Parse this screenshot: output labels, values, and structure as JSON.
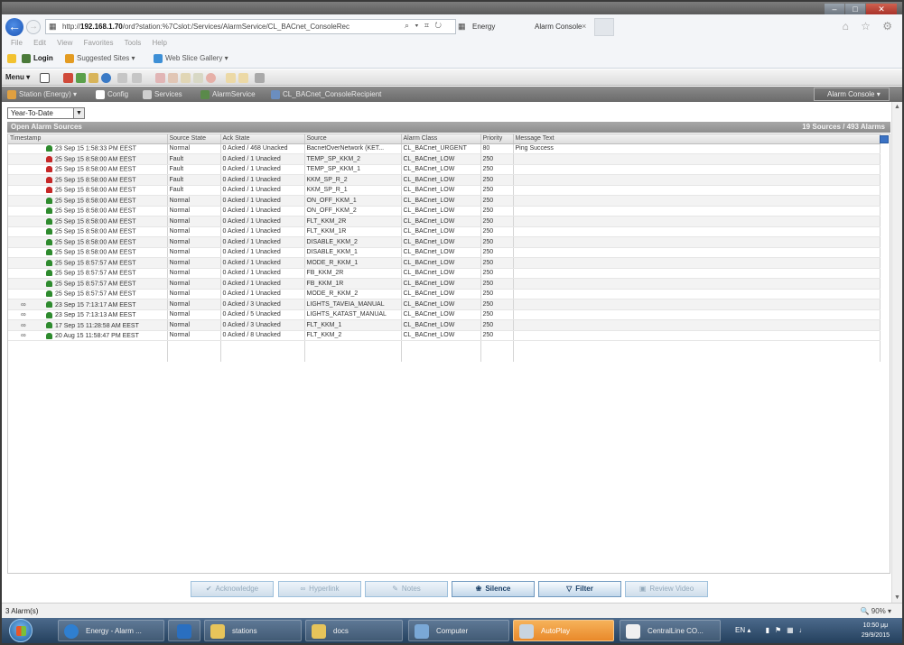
{
  "browser": {
    "url_prefix": "http://",
    "url_host": "192.168.1.70",
    "url_path": "/ord?station:%7Cslot:/Services/AlarmService/CL_BACnet_ConsoleRec",
    "url_tools": "⌕ ▾ ⌗ ↻",
    "tab_title": "Energy",
    "tab_title_2": "Alarm Console",
    "tab_close": "×",
    "right_icons": "⌂ ☆ ⚙"
  },
  "window_controls": {
    "minimize": "–",
    "maximize": "□",
    "close": "✕"
  },
  "menu": [
    "File",
    "Edit",
    "View",
    "Favorites",
    "Tools",
    "Help"
  ],
  "favorites": {
    "login": "Login",
    "suggested": "Suggested Sites ▾",
    "gallery": "Web Slice Gallery ▾"
  },
  "toolbar": {
    "menu_label": "Menu ▾"
  },
  "breadcrumb": {
    "station": "Station (Energy) ▾",
    "config": "Config",
    "services": "Services",
    "alarm_service": "AlarmService",
    "console_recipient": "CL_BACnet_ConsoleRecipient",
    "view_selector": "Alarm Console ▾"
  },
  "filter": {
    "range": "Year-To-Date",
    "dropdown": "▼"
  },
  "panel": {
    "title": "Open Alarm Sources",
    "count": "19 Sources / 493 Alarms"
  },
  "table": {
    "columns": [
      "Timestamp",
      "Source State",
      "Ack State",
      "Source",
      "Alarm Class",
      "Priority",
      "Message Text"
    ],
    "rows": [
      {
        "icon": "green",
        "ts": "23 Sep 15 1:58:33 PM EEST",
        "state": "Normal",
        "ack": "0 Acked / 468 Unacked",
        "source": "BacnetOverNetwork (KET...",
        "cls": "CL_BACnet_URGENT",
        "pri": "80",
        "msg": "Ping Success",
        "extra": ""
      },
      {
        "icon": "red",
        "ts": "25 Sep 15 8:58:00 AM EEST",
        "state": "Fault",
        "ack": "0 Acked / 1 Unacked",
        "source": "TEMP_SP_KKM_2",
        "cls": "CL_BACnet_LOW",
        "pri": "250",
        "msg": "",
        "extra": ""
      },
      {
        "icon": "red",
        "ts": "25 Sep 15 8:58:00 AM EEST",
        "state": "Fault",
        "ack": "0 Acked / 1 Unacked",
        "source": "TEMP_SP_KKM_1",
        "cls": "CL_BACnet_LOW",
        "pri": "250",
        "msg": "",
        "extra": ""
      },
      {
        "icon": "red",
        "ts": "25 Sep 15 8:58:00 AM EEST",
        "state": "Fault",
        "ack": "0 Acked / 1 Unacked",
        "source": "KKM_SP_R_2",
        "cls": "CL_BACnet_LOW",
        "pri": "250",
        "msg": "",
        "extra": ""
      },
      {
        "icon": "red",
        "ts": "25 Sep 15 8:58:00 AM EEST",
        "state": "Fault",
        "ack": "0 Acked / 1 Unacked",
        "source": "KKM_SP_R_1",
        "cls": "CL_BACnet_LOW",
        "pri": "250",
        "msg": "",
        "extra": ""
      },
      {
        "icon": "green",
        "ts": "25 Sep 15 8:58:00 AM EEST",
        "state": "Normal",
        "ack": "0 Acked / 1 Unacked",
        "source": "ON_OFF_KKM_1",
        "cls": "CL_BACnet_LOW",
        "pri": "250",
        "msg": "",
        "extra": ""
      },
      {
        "icon": "green",
        "ts": "25 Sep 15 8:58:00 AM EEST",
        "state": "Normal",
        "ack": "0 Acked / 1 Unacked",
        "source": "ON_OFF_KKM_2",
        "cls": "CL_BACnet_LOW",
        "pri": "250",
        "msg": "",
        "extra": ""
      },
      {
        "icon": "green",
        "ts": "25 Sep 15 8:58:00 AM EEST",
        "state": "Normal",
        "ack": "0 Acked / 1 Unacked",
        "source": "FLT_KKM_2R",
        "cls": "CL_BACnet_LOW",
        "pri": "250",
        "msg": "",
        "extra": ""
      },
      {
        "icon": "green",
        "ts": "25 Sep 15 8:58:00 AM EEST",
        "state": "Normal",
        "ack": "0 Acked / 1 Unacked",
        "source": "FLT_KKM_1R",
        "cls": "CL_BACnet_LOW",
        "pri": "250",
        "msg": "",
        "extra": ""
      },
      {
        "icon": "green",
        "ts": "25 Sep 15 8:58:00 AM EEST",
        "state": "Normal",
        "ack": "0 Acked / 1 Unacked",
        "source": "DISABLE_KKM_2",
        "cls": "CL_BACnet_LOW",
        "pri": "250",
        "msg": "",
        "extra": ""
      },
      {
        "icon": "green",
        "ts": "25 Sep 15 8:58:00 AM EEST",
        "state": "Normal",
        "ack": "0 Acked / 1 Unacked",
        "source": "DISABLE_KKM_1",
        "cls": "CL_BACnet_LOW",
        "pri": "250",
        "msg": "",
        "extra": ""
      },
      {
        "icon": "green",
        "ts": "25 Sep 15 8:57:57 AM EEST",
        "state": "Normal",
        "ack": "0 Acked / 1 Unacked",
        "source": "MODE_R_KKM_1",
        "cls": "CL_BACnet_LOW",
        "pri": "250",
        "msg": "",
        "extra": ""
      },
      {
        "icon": "green",
        "ts": "25 Sep 15 8:57:57 AM EEST",
        "state": "Normal",
        "ack": "0 Acked / 1 Unacked",
        "source": "FB_KKM_2R",
        "cls": "CL_BACnet_LOW",
        "pri": "250",
        "msg": "",
        "extra": ""
      },
      {
        "icon": "green",
        "ts": "25 Sep 15 8:57:57 AM EEST",
        "state": "Normal",
        "ack": "0 Acked / 1 Unacked",
        "source": "FB_KKM_1R",
        "cls": "CL_BACnet_LOW",
        "pri": "250",
        "msg": "",
        "extra": ""
      },
      {
        "icon": "green",
        "ts": "25 Sep 15 8:57:57 AM EEST",
        "state": "Normal",
        "ack": "0 Acked / 1 Unacked",
        "source": "MODE_R_KKM_2",
        "cls": "CL_BACnet_LOW",
        "pri": "250",
        "msg": "",
        "extra": ""
      },
      {
        "icon": "green",
        "ts": "23 Sep 15 7:13:17 AM EEST",
        "state": "Normal",
        "ack": "0 Acked / 3 Unacked",
        "source": "LIGHTS_TAVEIA_MANUAL",
        "cls": "CL_BACnet_LOW",
        "pri": "250",
        "msg": "",
        "extra": "∞"
      },
      {
        "icon": "green",
        "ts": "23 Sep 15 7:13:13 AM EEST",
        "state": "Normal",
        "ack": "0 Acked / 5 Unacked",
        "source": "LIGHTS_KATAST_MANUAL",
        "cls": "CL_BACnet_LOW",
        "pri": "250",
        "msg": "",
        "extra": "∞"
      },
      {
        "icon": "green",
        "ts": "17 Sep 15 11:28:58 AM EEST",
        "state": "Normal",
        "ack": "0 Acked / 3 Unacked",
        "source": "FLT_KKM_1",
        "cls": "CL_BACnet_LOW",
        "pri": "250",
        "msg": "",
        "extra": "∞"
      },
      {
        "icon": "green",
        "ts": "20 Aug 15 11:58:47 PM EEST",
        "state": "Normal",
        "ack": "0 Acked / 8 Unacked",
        "source": "FLT_KKM_2",
        "cls": "CL_BACnet_LOW",
        "pri": "250",
        "msg": "",
        "extra": "∞"
      }
    ]
  },
  "actions": {
    "acknowledge": "Acknowledge",
    "hyperlink": "Hyperlink",
    "notes": "Notes",
    "silence": "Silence",
    "filter": "Filter",
    "review_video": "Review Video"
  },
  "statusbar": {
    "left": "3 Alarm(s)",
    "zoom": "🔍 90% ▾"
  },
  "taskbar": {
    "items": [
      "Energy - Alarm ...",
      "",
      "stations",
      "docs",
      "Computer",
      "AutoPlay",
      "CentralLine CO..."
    ],
    "tray": "EN  ▴",
    "time": "10:50 μμ",
    "date": "29/9/2015"
  }
}
